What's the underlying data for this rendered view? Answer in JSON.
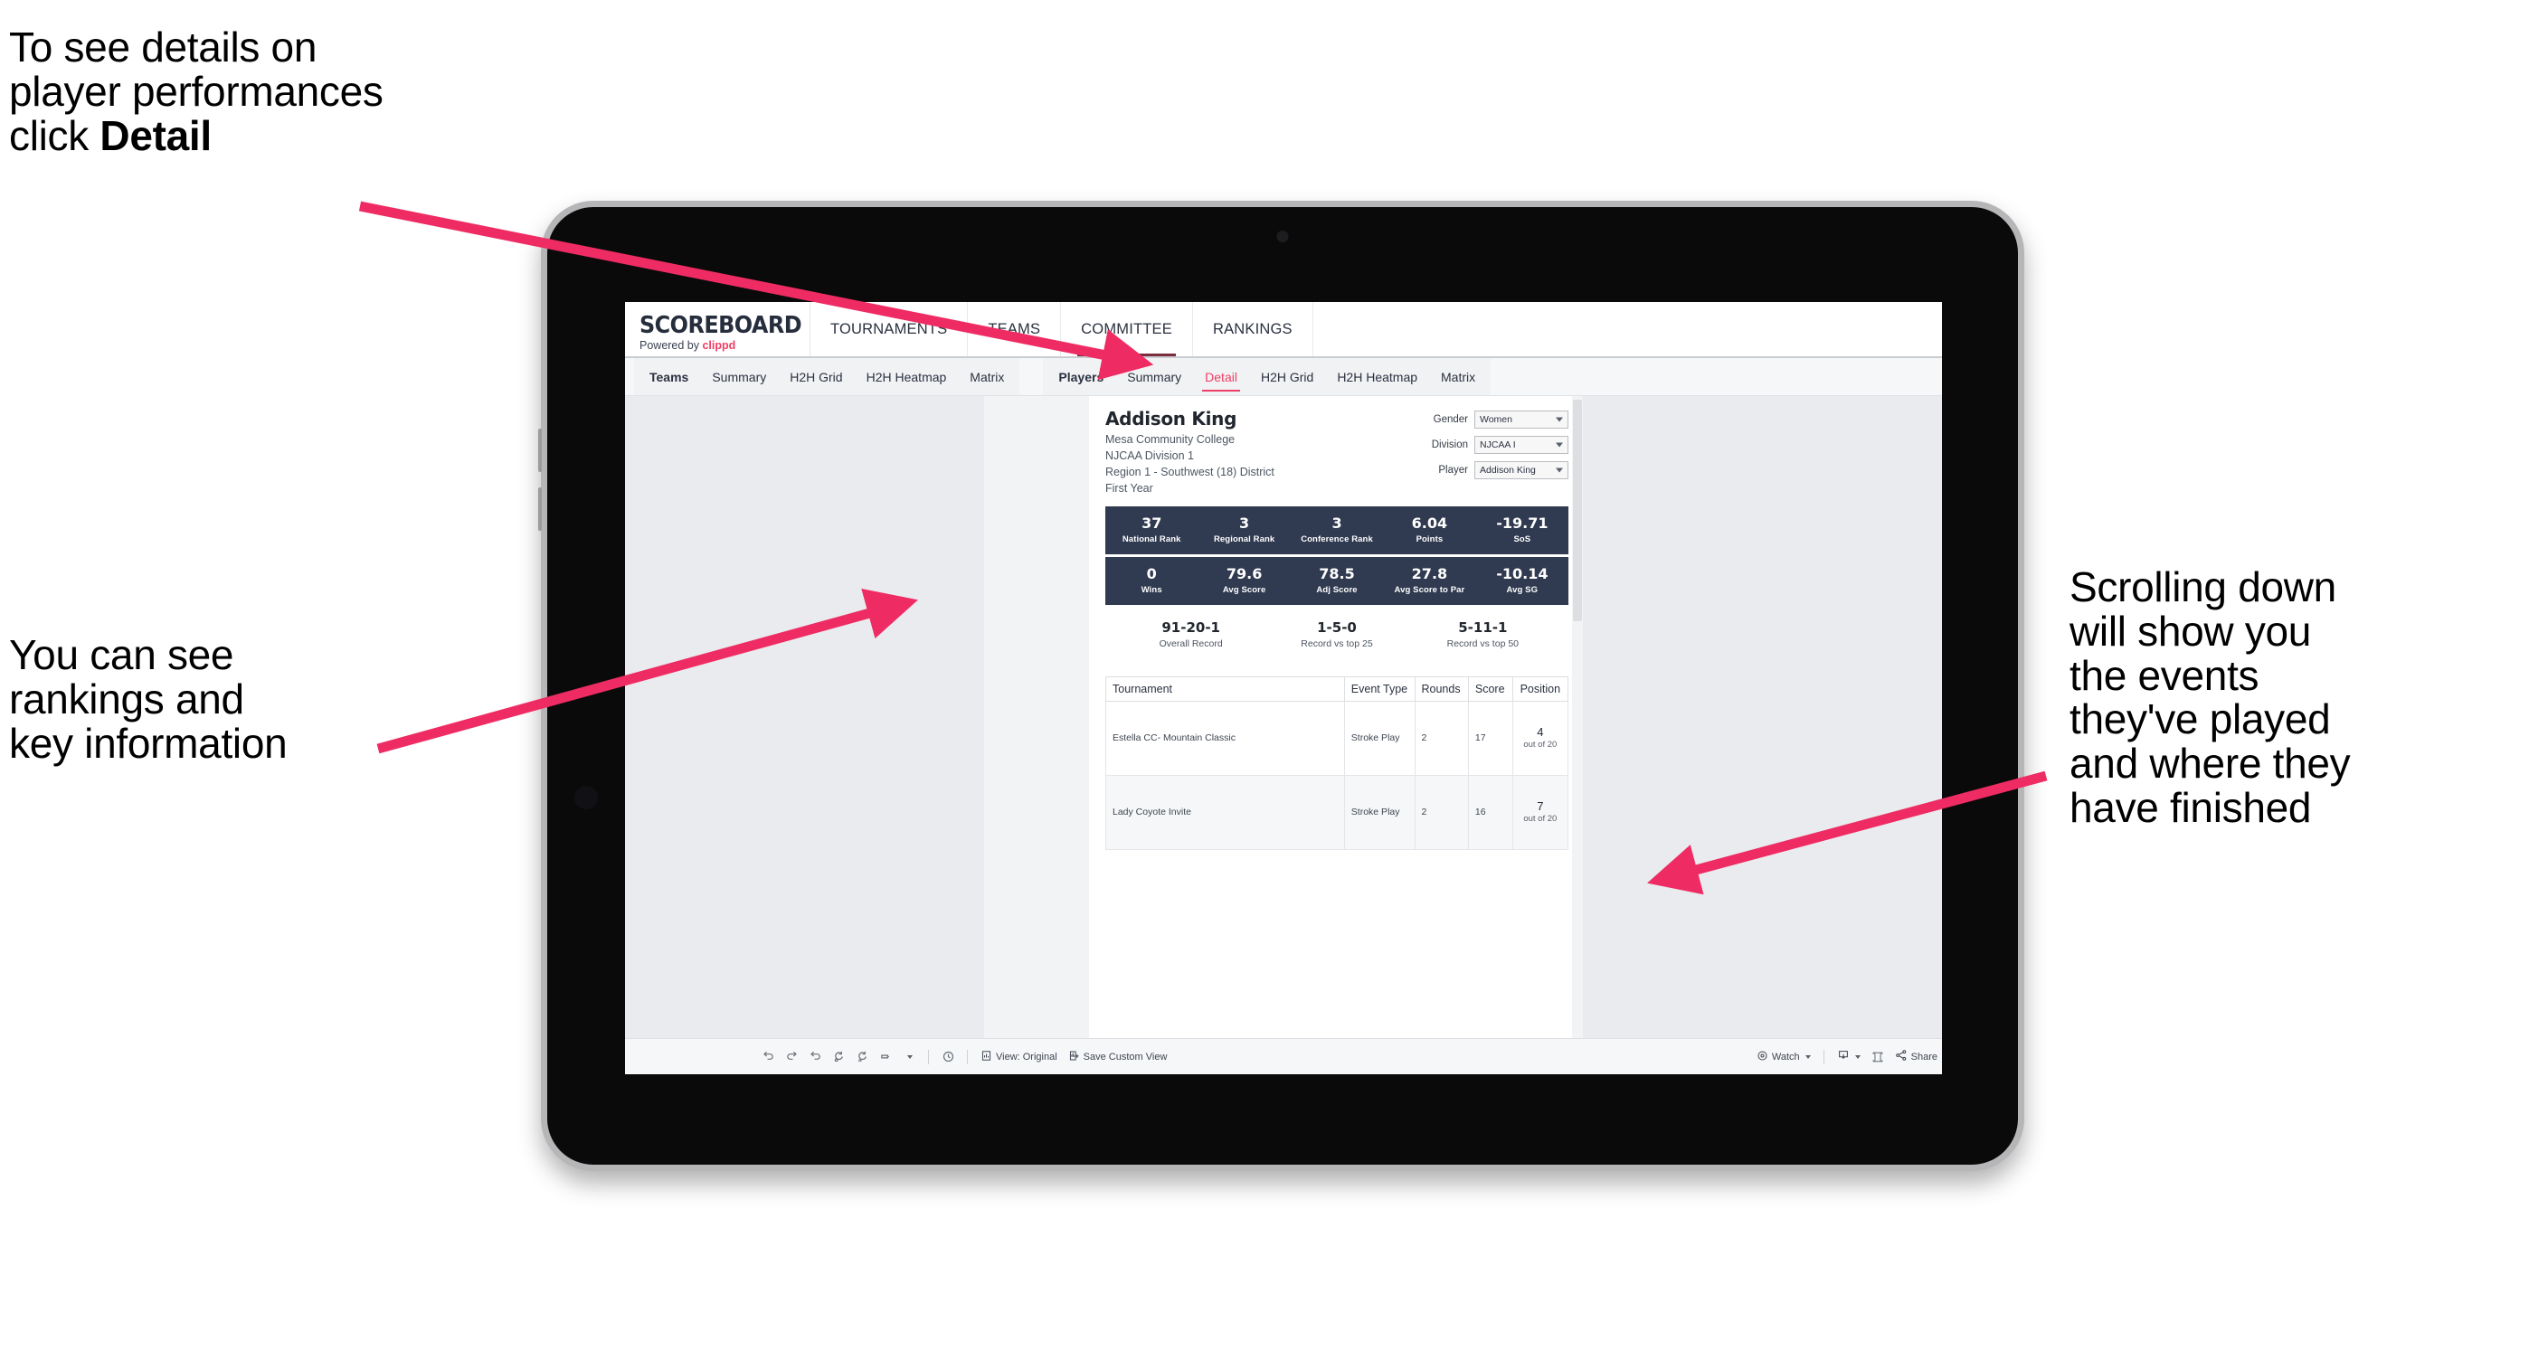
{
  "annotations": {
    "detail": {
      "pre": "To see details on\nplayer performances\nclick ",
      "bold": "Detail"
    },
    "rankings": "You can see\nrankings and\nkey information",
    "scrolling": "Scrolling down\nwill show you\nthe events\nthey've played\nand where they\nhave finished"
  },
  "colors": {
    "accent_pink": "#ef3e66",
    "stat_navy": "#303a50",
    "nav_underline": "#7a2b3c"
  },
  "header": {
    "logo_main": "SCOREBOARD",
    "logo_sub_prefix": "Powered by ",
    "logo_sub_brand": "clippd",
    "nav": [
      {
        "label": "TOURNAMENTS",
        "active": false
      },
      {
        "label": "TEAMS",
        "active": false
      },
      {
        "label": "COMMITTEE",
        "active": true
      },
      {
        "label": "RANKINGS",
        "active": false
      }
    ]
  },
  "subnav": {
    "teams_group": [
      {
        "label": "Teams",
        "lead": true,
        "active": false
      },
      {
        "label": "Summary",
        "lead": false,
        "active": false
      },
      {
        "label": "H2H Grid",
        "lead": false,
        "active": false
      },
      {
        "label": "H2H Heatmap",
        "lead": false,
        "active": false
      },
      {
        "label": "Matrix",
        "lead": false,
        "active": false
      }
    ],
    "players_group": [
      {
        "label": "Players",
        "lead": true,
        "active": false
      },
      {
        "label": "Summary",
        "lead": false,
        "active": false
      },
      {
        "label": "Detail",
        "lead": false,
        "active": true
      },
      {
        "label": "H2H Grid",
        "lead": false,
        "active": false
      },
      {
        "label": "H2H Heatmap",
        "lead": false,
        "active": false
      },
      {
        "label": "Matrix",
        "lead": false,
        "active": false
      }
    ]
  },
  "player": {
    "name": "Addison King",
    "meta": [
      "Mesa Community College",
      "NJCAA Division 1",
      "Region 1 - Southwest (18) District",
      "First Year"
    ]
  },
  "filters": [
    {
      "label": "Gender",
      "value": "Women"
    },
    {
      "label": "Division",
      "value": "NJCAA I"
    },
    {
      "label": "Player",
      "value": "Addison King"
    }
  ],
  "stats_row1": [
    {
      "value": "37",
      "label": "National Rank"
    },
    {
      "value": "3",
      "label": "Regional Rank"
    },
    {
      "value": "3",
      "label": "Conference Rank"
    },
    {
      "value": "6.04",
      "label": "Points"
    },
    {
      "value": "-19.71",
      "label": "SoS"
    }
  ],
  "stats_row2": [
    {
      "value": "0",
      "label": "Wins"
    },
    {
      "value": "79.6",
      "label": "Avg Score"
    },
    {
      "value": "78.5",
      "label": "Adj Score"
    },
    {
      "value": "27.8",
      "label": "Avg Score to Par"
    },
    {
      "value": "-10.14",
      "label": "Avg SG"
    }
  ],
  "records": [
    {
      "value": "91-20-1",
      "label": "Overall Record"
    },
    {
      "value": "1-5-0",
      "label": "Record vs top 25"
    },
    {
      "value": "5-11-1",
      "label": "Record vs top 50"
    }
  ],
  "table": {
    "columns": [
      "Tournament",
      "Event Type",
      "Rounds",
      "Score",
      "Position"
    ],
    "rows": [
      {
        "tournament": "Estella CC- Mountain Classic",
        "event_type": "Stroke Play",
        "rounds": "2",
        "score": "17",
        "position": "4",
        "position_sub": "out of 20"
      },
      {
        "tournament": "Lady Coyote Invite",
        "event_type": "Stroke Play",
        "rounds": "2",
        "score": "16",
        "position": "7",
        "position_sub": "out of 20"
      }
    ]
  },
  "toolbar": {
    "icons": [
      "undo-icon",
      "redo-icon",
      "revert-icon",
      "refresh-icon",
      "pause-icon",
      "highlight-icon"
    ],
    "clock_icon": "clock-icon",
    "view_label": "View: Original",
    "save_label": "Save Custom View",
    "watch_label": "Watch",
    "share_label": "Share",
    "download_icon": "download-icon",
    "device_icon": "device-icon",
    "share_icon": "share-icon"
  }
}
